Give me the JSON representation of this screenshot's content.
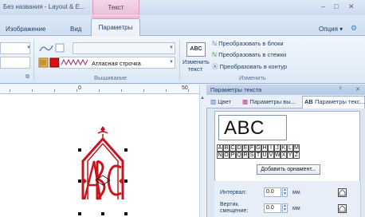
{
  "window": {
    "title": "Без названия - Layout & E...",
    "context_tab": "Текст",
    "minimize": "–",
    "maximize": "□",
    "close": "✕"
  },
  "ribbon": {
    "tabs": [
      "Изображение",
      "Вид",
      "Параметры"
    ],
    "active_tab": "Параметры",
    "right_option": "Опция",
    "groups": {
      "embroidery": {
        "label": "Вышивание",
        "stitch_type": "Атласная строчка"
      },
      "change": {
        "label": "Изменить",
        "abc_badge": "ABC",
        "change_text_line1": "Изменить",
        "change_text_line2": "текст",
        "convert_blocks": "Преобразовать в блоки",
        "convert_stitches": "Преобразовать в стежки",
        "convert_outline": "Преобразовать в контур"
      }
    }
  },
  "ruler": {
    "labels": [
      "0",
      "50"
    ]
  },
  "panel": {
    "title": "Параметры текста",
    "pin": "ᵖ",
    "close": "✕",
    "tabs": [
      "Цвет",
      "Параметры вы...",
      "Параметры текс..."
    ],
    "active_tab_index": 2,
    "preview_text": "ABC",
    "letters_row1": [
      "A",
      "B",
      "C",
      "D",
      "E",
      "F",
      "G",
      "H",
      "I",
      "J",
      "K",
      "L",
      "M"
    ],
    "letters_row2": [
      "N",
      "O",
      "P",
      "Q",
      "R",
      "S",
      "T",
      "U",
      "V",
      "W",
      "X",
      "Y",
      "Z"
    ],
    "add_ornament": "Добавить орнамент...",
    "interval_label": "Интервал:",
    "interval_value": "0.0",
    "interval_unit": "мм",
    "vert_label_line1": "Вертик.",
    "vert_label_line2": "смещение:",
    "vert_value": "0.0",
    "vert_unit": "мм"
  },
  "colors": {
    "accent_ribbon": "#dfe9f6",
    "context_tab": "#e9bfd6",
    "monogram": "#c8141e"
  }
}
